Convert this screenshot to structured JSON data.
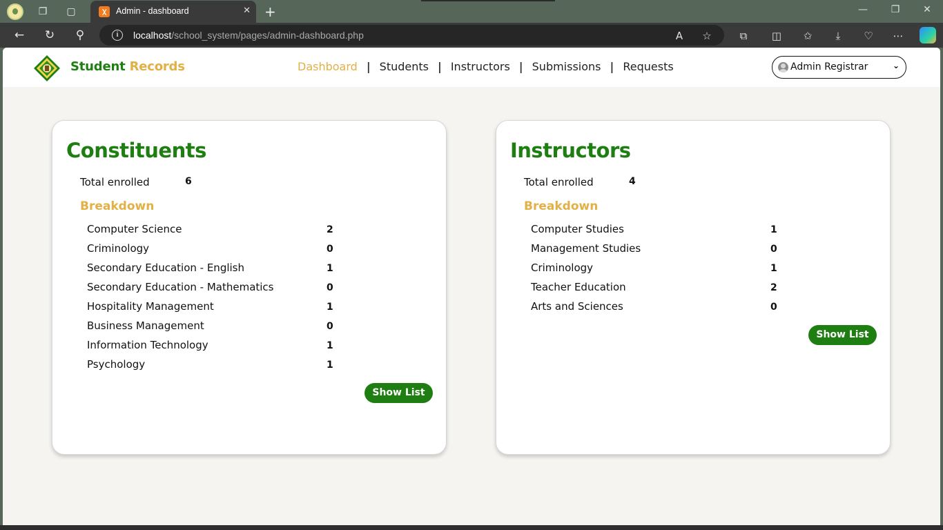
{
  "browser": {
    "tab_title": "Admin - dashboard",
    "url_host": "localhost",
    "url_path": "/school_system/pages/admin-dashboard.php"
  },
  "header": {
    "brand_part1": "Student",
    "brand_part2": " Records",
    "nav": [
      "Dashboard",
      "Students",
      "Instructors",
      "Submissions",
      "Requests"
    ],
    "active_nav": "Dashboard",
    "user_select": "Admin Registrar"
  },
  "constituents": {
    "title": "Constituents",
    "total_label": "Total enrolled",
    "total_value": "6",
    "breakdown_label": "Breakdown",
    "rows": [
      {
        "label": "Computer Science",
        "count": "2"
      },
      {
        "label": "Criminology",
        "count": "0"
      },
      {
        "label": "Secondary Education - English",
        "count": "1"
      },
      {
        "label": "Secondary Education - Mathematics",
        "count": "0"
      },
      {
        "label": "Hospitality Management",
        "count": "1"
      },
      {
        "label": "Business Management",
        "count": "0"
      },
      {
        "label": "Information Technology",
        "count": "1"
      },
      {
        "label": "Psychology",
        "count": "1"
      }
    ],
    "button_label": "Show List"
  },
  "instructors": {
    "title": "Instructors",
    "total_label": "Total enrolled",
    "total_value": "4",
    "breakdown_label": "Breakdown",
    "rows": [
      {
        "label": "Computer Studies",
        "count": "1"
      },
      {
        "label": "Management Studies",
        "count": "0"
      },
      {
        "label": "Criminology",
        "count": "1"
      },
      {
        "label": "Teacher Education",
        "count": "2"
      },
      {
        "label": "Arts and Sciences",
        "count": "0"
      }
    ],
    "button_label": "Show List"
  },
  "colors": {
    "brand_green": "#1e7e12",
    "accent_gold": "#e2b045"
  }
}
